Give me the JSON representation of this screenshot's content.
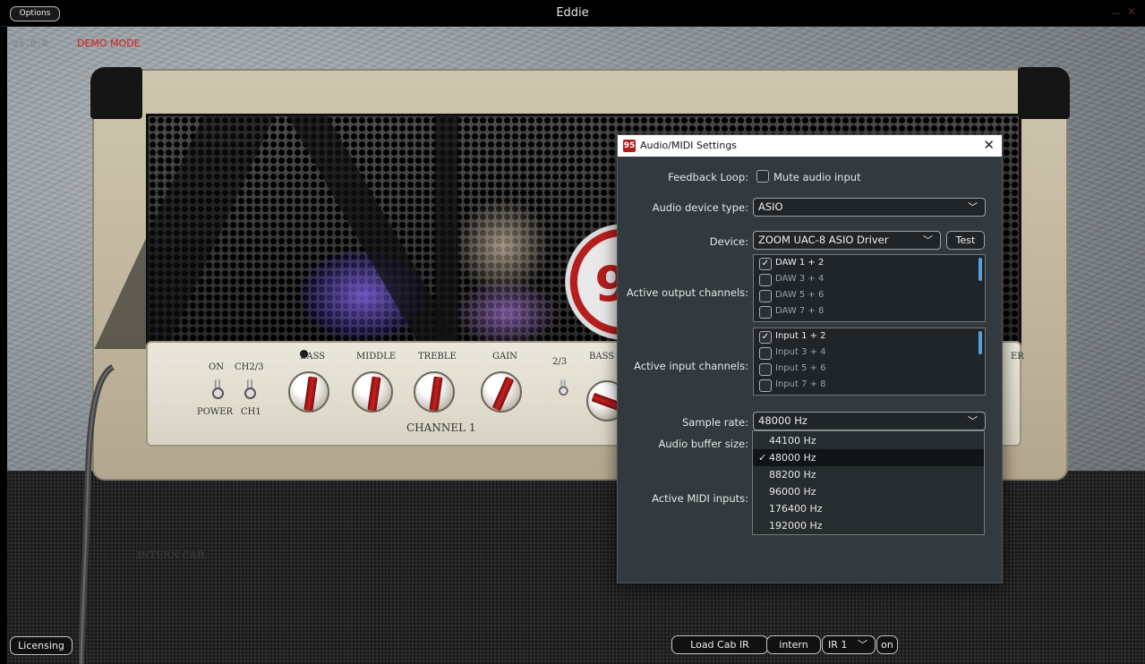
{
  "window": {
    "title": "Eddie",
    "options_label": "Options",
    "minimize": "—",
    "close": "✕"
  },
  "app": {
    "version": "v1.0.0",
    "demo_mode": "DEMO MODE",
    "cab_label": "INTERN CAB"
  },
  "amp": {
    "logo_text": "95",
    "labels": {
      "on": "ON",
      "ch23": "CH2/3",
      "power": "POWER",
      "ch1": "CH1",
      "bass": "BASS",
      "middle": "MIDDLE",
      "treble": "TREBLE",
      "gain": "GAIN",
      "ch_switch": "2/3",
      "bass2": "BASS",
      "channel1": "CHANNEL 1",
      "master_partial": "ER"
    }
  },
  "bottom": {
    "licensing": "Licensing",
    "load_cab_ir": "Load Cab IR",
    "intern": "intern",
    "ir_select": "IR 1",
    "ir_on": "on"
  },
  "dialog": {
    "title": "Audio/MIDI Settings",
    "icon_text": "95",
    "close": "✕",
    "feedback_loop_label": "Feedback Loop:",
    "mute_audio_input": "Mute audio input",
    "audio_device_type_label": "Audio device type:",
    "audio_device_type_value": "ASIO",
    "device_label": "Device:",
    "device_value": "ZOOM UAC-8 ASIO Driver",
    "test_label": "Test",
    "active_output_label": "Active output channels:",
    "output_channels": [
      {
        "label": "DAW 1 + 2",
        "checked": true
      },
      {
        "label": "DAW 3 + 4",
        "checked": false
      },
      {
        "label": "DAW 5 + 6",
        "checked": false
      },
      {
        "label": "DAW 7 + 8",
        "checked": false
      }
    ],
    "active_input_label": "Active input channels:",
    "input_channels": [
      {
        "label": "Input 1 + 2",
        "checked": true
      },
      {
        "label": "Input 3 + 4",
        "checked": false
      },
      {
        "label": "Input 5 + 6",
        "checked": false
      },
      {
        "label": "Input 7 + 8",
        "checked": false
      }
    ],
    "sample_rate_label": "Sample rate:",
    "sample_rate_value": "48000 Hz",
    "buffer_size_label": "Audio buffer size:",
    "midi_inputs_label": "Active MIDI inputs:",
    "sample_rate_options": [
      {
        "label": "44100 Hz",
        "selected": false
      },
      {
        "label": "48000 Hz",
        "selected": true
      },
      {
        "label": "88200 Hz",
        "selected": false
      },
      {
        "label": "96000 Hz",
        "selected": false
      },
      {
        "label": "176400 Hz",
        "selected": false
      },
      {
        "label": "192000 Hz",
        "selected": false
      }
    ],
    "check_mark": "✓",
    "chevron": "﹀"
  }
}
